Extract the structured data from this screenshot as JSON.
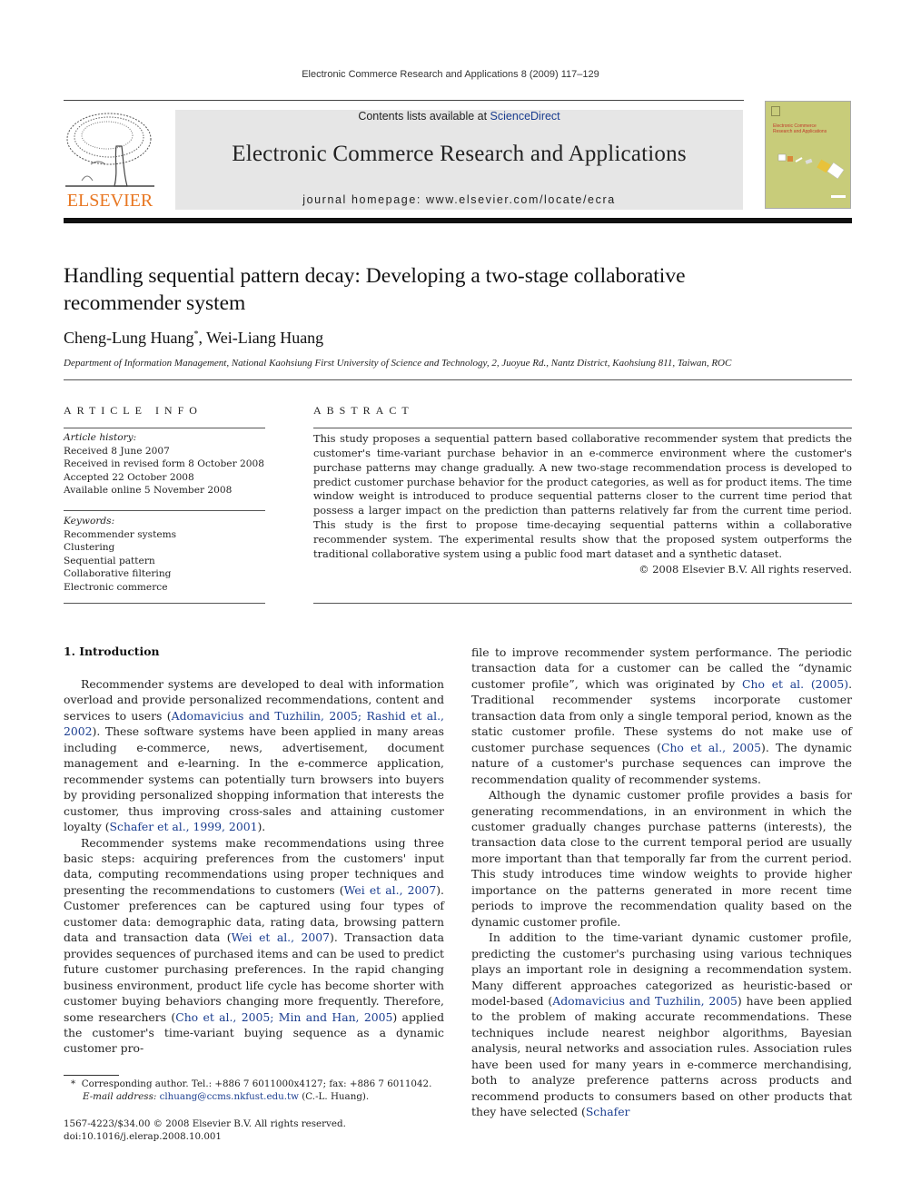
{
  "running_head": "Electronic Commerce Research and Applications 8 (2009) 117–129",
  "banner": {
    "contents_prefix": "Contents lists available at ",
    "contents_link": "ScienceDirect",
    "journal_name": "Electronic Commerce Research and Applications",
    "homepage": "journal homepage: www.elsevier.com/locate/ecra",
    "publisher_logo_text": "ELSEVIER",
    "cover_title_1": "Electronic Commerce",
    "cover_title_2": "Research and Applications",
    "colors": {
      "link": "#1a3d8f",
      "elsevier_orange": "#e87722",
      "banner_bg": "#e6e6e6",
      "cover_bg": "#c8cc7a"
    }
  },
  "article": {
    "title_line1": "Handling sequential pattern decay: Developing a two-stage collaborative",
    "title_line2": "recommender system",
    "author1": "Cheng-Lung Huang",
    "author1_mark": "*",
    "author_sep": ", ",
    "author2": "Wei-Liang Huang",
    "affiliation": "Department of Information Management, National Kaohsiung First University of Science and Technology, 2, Juoyue Rd., Nantz District, Kaohsiung 811, Taiwan, ROC"
  },
  "article_info": {
    "heading": "ARTICLE INFO",
    "history_label": "Article history:",
    "history": [
      "Received 8 June 2007",
      "Received in revised form 8 October 2008",
      "Accepted 22 October 2008",
      "Available online 5 November 2008"
    ],
    "keywords_label": "Keywords:",
    "keywords": [
      "Recommender systems",
      "Clustering",
      "Sequential pattern",
      "Collaborative filtering",
      "Electronic commerce"
    ]
  },
  "abstract": {
    "heading": "ABSTRACT",
    "text": "This study proposes a sequential pattern based collaborative recommender system that predicts the customer's time-variant purchase behavior in an e-commerce environment where the customer's purchase patterns may change gradually. A new two-stage recommendation process is developed to predict customer purchase behavior for the product categories, as well as for product items. The time window weight is introduced to produce sequential patterns closer to the current time period that possess a larger impact on the prediction than patterns relatively far from the current time period. This study is the first to propose time-decaying sequential patterns within a collaborative recommender system. The experimental results show that the proposed system outperforms the traditional collaborative system using a public food mart dataset and a synthetic dataset.",
    "copyright": "© 2008 Elsevier B.V. All rights reserved."
  },
  "body": {
    "section_heading": "1. Introduction",
    "p1": {
      "t1": "Recommender systems are developed to deal with information overload and provide personalized recommendations, content and services to users (",
      "l1": "Adomavicius and Tuzhilin, 2005; Rashid et al., 2002",
      "t2": "). These software systems have been applied in many areas including e-commerce, news, advertisement, document management and e-learning. In the e-commerce application, recommender systems can potentially turn browsers into buyers by providing personalized shopping information that interests the customer, thus improving cross-sales and attaining customer loyalty (",
      "l2": "Schafer et al., 1999, 2001",
      "t3": ")."
    },
    "p2": {
      "t1": "Recommender systems make recommendations using three basic steps: acquiring preferences from the customers' input data, computing recommendations using proper techniques and presenting the recommendations to customers (",
      "l1": "Wei et al., 2007",
      "t2": "). Customer preferences can be captured using four types of customer data: demographic data, rating data, browsing pattern data and transaction data (",
      "l2": "Wei et al., 2007",
      "t3": "). Transaction data provides sequences of purchased items and can be used to predict future customer purchasing preferences. In the rapid changing business environment, product life cycle has become shorter with customer buying behaviors changing more frequently. Therefore, some researchers (",
      "l3": "Cho et al., 2005; Min and Han, 2005",
      "t4": ") applied the customer's time-variant buying sequence as a dynamic customer pro-"
    },
    "p2_cont": {
      "t1": "file to improve recommender system performance. The periodic transaction data for a customer can be called the “dynamic customer profile”, which was originated by ",
      "l1": "Cho et al. (2005)",
      "t2": ". Traditional recommender systems incorporate customer transaction data from only a single temporal period, known as the static customer profile. These systems do not make use of customer purchase sequences (",
      "l2": "Cho et al., 2005",
      "t3": "). The dynamic nature of a customer's purchase sequences can improve the recommendation quality of recommender systems."
    },
    "p3": "Although the dynamic customer profile provides a basis for generating recommendations, in an environment in which the customer gradually changes purchase patterns (interests), the transaction data close to the current temporal period are usually more important than that temporally far from the current period. This study introduces time window weights to provide higher importance on the patterns generated in more recent time periods to improve the recommendation quality based on the dynamic customer profile.",
    "p4": {
      "t1": "In addition to the time-variant dynamic customer profile, predicting the customer's purchasing using various techniques plays an important role in designing a recommendation system. Many different approaches categorized as heuristic-based or model-based (",
      "l1": "Adomavicius and Tuzhilin, 2005",
      "t2": ") have been applied to the problem of making accurate recommendations. These techniques include nearest neighbor algorithms, Bayesian analysis, neural networks and association rules. Association rules have been used for many years in e-commerce merchandising, both to analyze preference patterns across products and recommend products to consumers based on other products that they have selected (",
      "l2": "Schafer"
    }
  },
  "footnote": {
    "mark": "*",
    "corresponding": "Corresponding author. Tel.: +886 7 6011000x4127; fax: +886 7 6011042.",
    "email_label": "E-mail address:",
    "email": "clhuang@ccms.nkfust.edu.tw",
    "email_suffix": " (C.-L. Huang)."
  },
  "issn": {
    "line1": "1567-4223/$34.00 © 2008 Elsevier B.V. All rights reserved.",
    "line2": "doi:10.1016/j.elerap.2008.10.001"
  }
}
